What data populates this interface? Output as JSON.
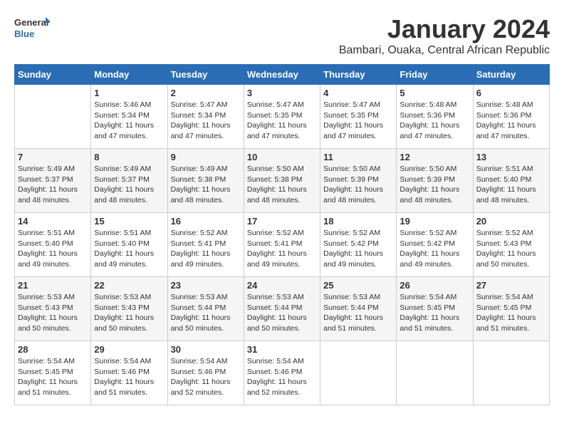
{
  "logo": {
    "general": "General",
    "blue": "Blue"
  },
  "title": "January 2024",
  "subtitle": "Bambari, Ouaka, Central African Republic",
  "days_of_week": [
    "Sunday",
    "Monday",
    "Tuesday",
    "Wednesday",
    "Thursday",
    "Friday",
    "Saturday"
  ],
  "weeks": [
    [
      {
        "day": "",
        "sunrise": "",
        "sunset": "",
        "daylight": ""
      },
      {
        "day": "1",
        "sunrise": "Sunrise: 5:46 AM",
        "sunset": "Sunset: 5:34 PM",
        "daylight": "Daylight: 11 hours and 47 minutes."
      },
      {
        "day": "2",
        "sunrise": "Sunrise: 5:47 AM",
        "sunset": "Sunset: 5:34 PM",
        "daylight": "Daylight: 11 hours and 47 minutes."
      },
      {
        "day": "3",
        "sunrise": "Sunrise: 5:47 AM",
        "sunset": "Sunset: 5:35 PM",
        "daylight": "Daylight: 11 hours and 47 minutes."
      },
      {
        "day": "4",
        "sunrise": "Sunrise: 5:47 AM",
        "sunset": "Sunset: 5:35 PM",
        "daylight": "Daylight: 11 hours and 47 minutes."
      },
      {
        "day": "5",
        "sunrise": "Sunrise: 5:48 AM",
        "sunset": "Sunset: 5:36 PM",
        "daylight": "Daylight: 11 hours and 47 minutes."
      },
      {
        "day": "6",
        "sunrise": "Sunrise: 5:48 AM",
        "sunset": "Sunset: 5:36 PM",
        "daylight": "Daylight: 11 hours and 47 minutes."
      }
    ],
    [
      {
        "day": "7",
        "sunrise": "Sunrise: 5:49 AM",
        "sunset": "Sunset: 5:37 PM",
        "daylight": "Daylight: 11 hours and 48 minutes."
      },
      {
        "day": "8",
        "sunrise": "Sunrise: 5:49 AM",
        "sunset": "Sunset: 5:37 PM",
        "daylight": "Daylight: 11 hours and 48 minutes."
      },
      {
        "day": "9",
        "sunrise": "Sunrise: 5:49 AM",
        "sunset": "Sunset: 5:38 PM",
        "daylight": "Daylight: 11 hours and 48 minutes."
      },
      {
        "day": "10",
        "sunrise": "Sunrise: 5:50 AM",
        "sunset": "Sunset: 5:38 PM",
        "daylight": "Daylight: 11 hours and 48 minutes."
      },
      {
        "day": "11",
        "sunrise": "Sunrise: 5:50 AM",
        "sunset": "Sunset: 5:39 PM",
        "daylight": "Daylight: 11 hours and 48 minutes."
      },
      {
        "day": "12",
        "sunrise": "Sunrise: 5:50 AM",
        "sunset": "Sunset: 5:39 PM",
        "daylight": "Daylight: 11 hours and 48 minutes."
      },
      {
        "day": "13",
        "sunrise": "Sunrise: 5:51 AM",
        "sunset": "Sunset: 5:40 PM",
        "daylight": "Daylight: 11 hours and 48 minutes."
      }
    ],
    [
      {
        "day": "14",
        "sunrise": "Sunrise: 5:51 AM",
        "sunset": "Sunset: 5:40 PM",
        "daylight": "Daylight: 11 hours and 49 minutes."
      },
      {
        "day": "15",
        "sunrise": "Sunrise: 5:51 AM",
        "sunset": "Sunset: 5:40 PM",
        "daylight": "Daylight: 11 hours and 49 minutes."
      },
      {
        "day": "16",
        "sunrise": "Sunrise: 5:52 AM",
        "sunset": "Sunset: 5:41 PM",
        "daylight": "Daylight: 11 hours and 49 minutes."
      },
      {
        "day": "17",
        "sunrise": "Sunrise: 5:52 AM",
        "sunset": "Sunset: 5:41 PM",
        "daylight": "Daylight: 11 hours and 49 minutes."
      },
      {
        "day": "18",
        "sunrise": "Sunrise: 5:52 AM",
        "sunset": "Sunset: 5:42 PM",
        "daylight": "Daylight: 11 hours and 49 minutes."
      },
      {
        "day": "19",
        "sunrise": "Sunrise: 5:52 AM",
        "sunset": "Sunset: 5:42 PM",
        "daylight": "Daylight: 11 hours and 49 minutes."
      },
      {
        "day": "20",
        "sunrise": "Sunrise: 5:52 AM",
        "sunset": "Sunset: 5:43 PM",
        "daylight": "Daylight: 11 hours and 50 minutes."
      }
    ],
    [
      {
        "day": "21",
        "sunrise": "Sunrise: 5:53 AM",
        "sunset": "Sunset: 5:43 PM",
        "daylight": "Daylight: 11 hours and 50 minutes."
      },
      {
        "day": "22",
        "sunrise": "Sunrise: 5:53 AM",
        "sunset": "Sunset: 5:43 PM",
        "daylight": "Daylight: 11 hours and 50 minutes."
      },
      {
        "day": "23",
        "sunrise": "Sunrise: 5:53 AM",
        "sunset": "Sunset: 5:44 PM",
        "daylight": "Daylight: 11 hours and 50 minutes."
      },
      {
        "day": "24",
        "sunrise": "Sunrise: 5:53 AM",
        "sunset": "Sunset: 5:44 PM",
        "daylight": "Daylight: 11 hours and 50 minutes."
      },
      {
        "day": "25",
        "sunrise": "Sunrise: 5:53 AM",
        "sunset": "Sunset: 5:44 PM",
        "daylight": "Daylight: 11 hours and 51 minutes."
      },
      {
        "day": "26",
        "sunrise": "Sunrise: 5:54 AM",
        "sunset": "Sunset: 5:45 PM",
        "daylight": "Daylight: 11 hours and 51 minutes."
      },
      {
        "day": "27",
        "sunrise": "Sunrise: 5:54 AM",
        "sunset": "Sunset: 5:45 PM",
        "daylight": "Daylight: 11 hours and 51 minutes."
      }
    ],
    [
      {
        "day": "28",
        "sunrise": "Sunrise: 5:54 AM",
        "sunset": "Sunset: 5:45 PM",
        "daylight": "Daylight: 11 hours and 51 minutes."
      },
      {
        "day": "29",
        "sunrise": "Sunrise: 5:54 AM",
        "sunset": "Sunset: 5:46 PM",
        "daylight": "Daylight: 11 hours and 51 minutes."
      },
      {
        "day": "30",
        "sunrise": "Sunrise: 5:54 AM",
        "sunset": "Sunset: 5:46 PM",
        "daylight": "Daylight: 11 hours and 52 minutes."
      },
      {
        "day": "31",
        "sunrise": "Sunrise: 5:54 AM",
        "sunset": "Sunset: 5:46 PM",
        "daylight": "Daylight: 11 hours and 52 minutes."
      },
      {
        "day": "",
        "sunrise": "",
        "sunset": "",
        "daylight": ""
      },
      {
        "day": "",
        "sunrise": "",
        "sunset": "",
        "daylight": ""
      },
      {
        "day": "",
        "sunrise": "",
        "sunset": "",
        "daylight": ""
      }
    ]
  ]
}
